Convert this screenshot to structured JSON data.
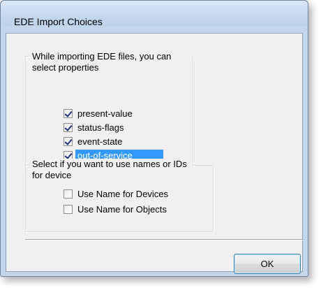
{
  "window": {
    "title": "EDE Import Choices"
  },
  "properties_group": {
    "text": "While importing EDE files, you can select properties",
    "options": [
      {
        "label": "present-value",
        "checked": true,
        "selected": false
      },
      {
        "label": "status-flags",
        "checked": true,
        "selected": false
      },
      {
        "label": "event-state",
        "checked": true,
        "selected": false
      },
      {
        "label": "out-of-service",
        "checked": true,
        "selected": true
      }
    ]
  },
  "names_group": {
    "text": "Select if you want to use names or IDs for device",
    "options": [
      {
        "label": "Use Name for Devices",
        "checked": false
      },
      {
        "label": "Use Name for Objects",
        "checked": false
      }
    ]
  },
  "buttons": {
    "ok_label": "OK"
  },
  "colors": {
    "selection": "#3399ff",
    "dialog_face": "#f0f0f0",
    "window_frame": "#c4d6eb"
  }
}
